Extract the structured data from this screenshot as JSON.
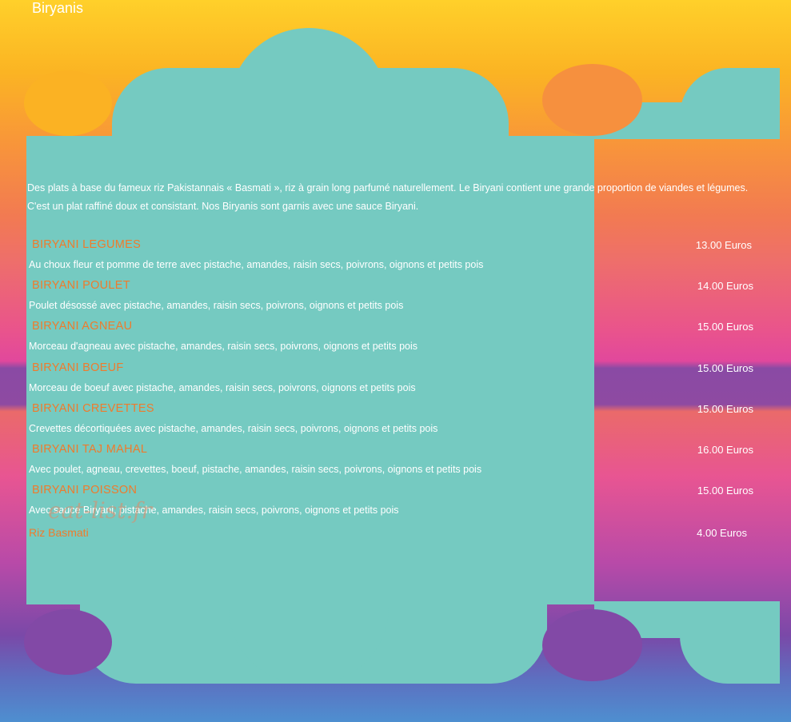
{
  "page": {
    "title": "Biryanis"
  },
  "intro": "Des plats à base du fameux riz Pakistannais « Basmati », riz à grain long parfumé naturellement. Le Biryani contient une grande proportion de viandes et légumes. C'est un plat raffiné doux et consistant. Nos Biryanis sont garnis avec une sauce Biryani.",
  "items": [
    {
      "name": "BIRYANI LEGUMES",
      "price": "13.00 Euros",
      "desc": "Au choux fleur et pomme de terre avec pistache, amandes, raisin secs, poivrons, oignons et petits pois"
    },
    {
      "name": "BIRYANI POULET",
      "price": "14.00 Euros",
      "desc": "Poulet désossé avec pistache, amandes, raisin secs, poivrons, oignons et petits pois"
    },
    {
      "name": "BIRYANI AGNEAU",
      "price": "15.00 Euros",
      "desc": "Morceau d'agneau avec pistache, amandes, raisin secs, poivrons, oignons et petits pois"
    },
    {
      "name": "BIRYANI BOEUF",
      "price": "15.00 Euros",
      "desc": "Morceau de boeuf avec pistache, amandes, raisin secs, poivrons, oignons et petits pois"
    },
    {
      "name": "BIRYANI CREVETTES",
      "price": "15.00 Euros",
      "desc": "Crevettes décortiquées avec pistache, amandes, raisin secs, poivrons, oignons et petits pois"
    },
    {
      "name": "BIRYANI TAJ MAHAL",
      "price": "16.00 Euros",
      "desc": "Avec poulet, agneau, crevettes, boeuf, pistache, amandes, raisin secs, poivrons, oignons et petits pois"
    },
    {
      "name": "BIRYANI POISSON",
      "price": "15.00 Euros",
      "desc": "Avec sauce Biryani, pistache, amandes, raisin secs, poivrons, oignons et petits pois"
    }
  ],
  "extra": {
    "name": "Riz Basmati",
    "price": "4.00 Euros"
  },
  "watermark": "eat-list.fr",
  "colors": {
    "panel": "#75cac1",
    "item_name": "#ef7b2c",
    "text": "#ffffff"
  }
}
